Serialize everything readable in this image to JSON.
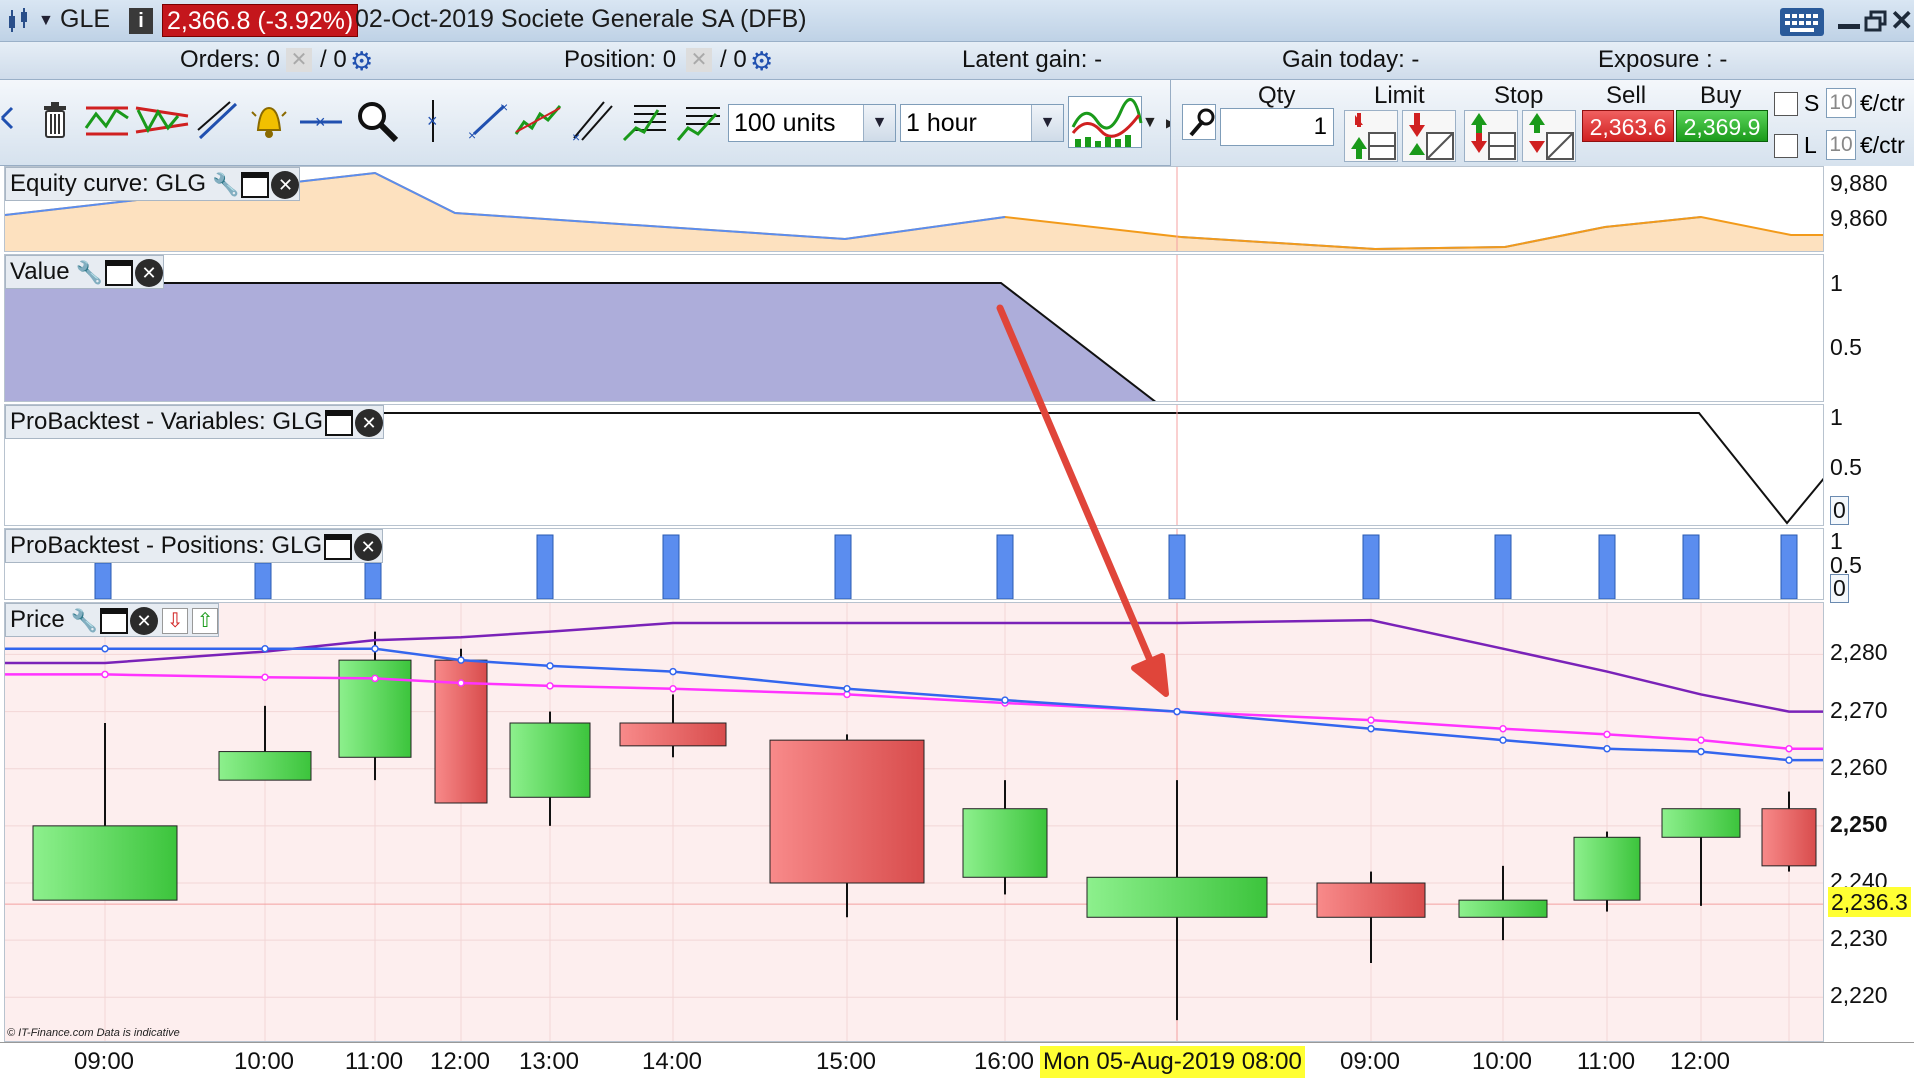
{
  "titlebar": {
    "symbol": "GLE",
    "price_change": "2,366.8 (-3.92%)",
    "date_name": "02-Oct-2019 Societe Generale SA (DFB)"
  },
  "infobar": {
    "orders_label": "Orders: 0",
    "orders_sep": "/ 0",
    "position_label": "Position: 0",
    "position_sep": "/ 0",
    "latent_gain": "Latent gain: -",
    "gain_today": "Gain today: -",
    "exposure": "Exposure : -"
  },
  "toolbar": {
    "units": "100 units",
    "timeframe": "1 hour",
    "qty_header": "Qty",
    "qty_value": "1",
    "limit_header": "Limit",
    "stop_header": "Stop",
    "sell_header": "Sell",
    "sell_price": "2,363.6",
    "buy_header": "Buy",
    "buy_price": "2,369.9",
    "s_label": "S",
    "l_label": "L",
    "s_amount": "10",
    "l_amount": "10",
    "unit_suffix": "€/ctr"
  },
  "panels": {
    "equity": {
      "title": "Equity curve: GLG",
      "ticks": [
        "9,880",
        "9,860"
      ]
    },
    "value": {
      "title": "Value",
      "ticks": [
        "1",
        "0.5"
      ]
    },
    "variables": {
      "title": "ProBacktest - Variables: GLG",
      "ticks": [
        "1",
        "0.5",
        "0"
      ]
    },
    "positions": {
      "title": "ProBacktest - Positions: GLG",
      "ticks": [
        "1",
        "0.5",
        "0"
      ]
    },
    "price": {
      "title": "Price",
      "ticks": [
        "2,280",
        "2,270",
        "2,260",
        "2,250",
        "2,240",
        "2,230",
        "2,220"
      ],
      "current": "2,236.3",
      "copyright": "© IT-Finance.com  Data is indicative"
    }
  },
  "xaxis": {
    "labels": [
      "09:00",
      "10:00",
      "11:00",
      "12:00",
      "13:00",
      "14:00",
      "15:00",
      "16:00",
      "09:00",
      "10:00",
      "11:00",
      "12:00"
    ],
    "crosshair_label": "Mon 05-Aug-2019 08:00"
  },
  "chart_data": {
    "type": "candlestick",
    "x": [
      "09:00",
      "10:00",
      "11:00",
      "12:00",
      "13:00",
      "14:00",
      "15:00",
      "16:00",
      "08:00",
      "09:00",
      "10:00",
      "11:00",
      "12:00",
      "13:00"
    ],
    "open": [
      2237,
      2258,
      2262,
      2279,
      2255,
      2268,
      2265,
      2241,
      2234,
      2240,
      2234,
      2237,
      2248,
      2253
    ],
    "high": [
      2268,
      2271,
      2284,
      2281,
      2270,
      2273,
      2266,
      2258,
      2258,
      2242,
      2243,
      2249,
      2253,
      2256
    ],
    "low": [
      2245,
      2258,
      2258,
      2254,
      2250,
      2262,
      2234,
      2238,
      2216,
      2226,
      2230,
      2235,
      2236,
      2242
    ],
    "close": [
      2250,
      2263,
      2279,
      2254,
      2268,
      2264,
      2240,
      2253,
      2241,
      2234,
      2237,
      2248,
      2253,
      2243
    ],
    "ylim": [
      2212,
      2289
    ],
    "series": [
      {
        "values": [
          2278.5,
          2280.5,
          2282.5,
          2283,
          2284,
          2285.5,
          2285.5,
          2285.5,
          2285.5,
          2286,
          2281,
          2277,
          2273,
          2270
        ],
        "color": "#7a22b8"
      },
      {
        "values": [
          2276.5,
          2276,
          2275.8,
          2275,
          2274.5,
          2274,
          2273,
          2271.5,
          2270,
          2268.5,
          2267,
          2266,
          2265,
          2263.5
        ],
        "color": "#ff33ff"
      },
      {
        "values": [
          2281,
          2281,
          2281,
          2279,
          2278,
          2277,
          2274,
          2272,
          2270,
          2267,
          2265,
          2263.5,
          2263,
          2261.5
        ],
        "color": "#3366ee"
      }
    ]
  }
}
